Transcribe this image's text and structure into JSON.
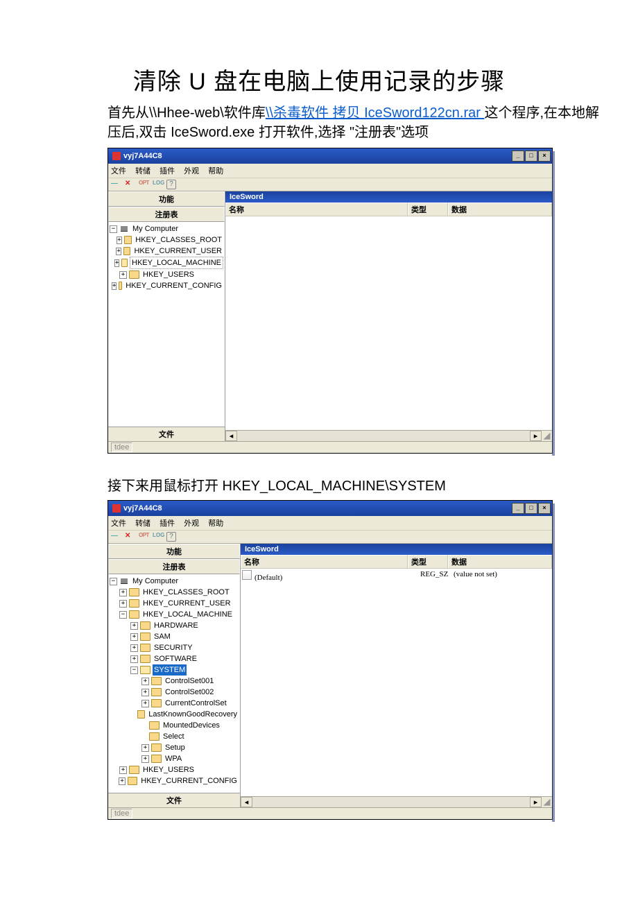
{
  "title": "清除 U 盘在电脑上使用记录的步骤",
  "intro_pre": "首先从\\\\Hhee-web\\软件库",
  "intro_link": "\\\\杀毒软件  拷贝 IceSword122cn.rar ",
  "intro_post": "这个程序,在本地解压后,双击 IceSword.exe 打开软件,选择  \"注册表\"选项",
  "step2": "接下来用鼠标打开 HKEY_LOCAL_MACHINE\\SYSTEM",
  "app": {
    "title": "vyj7A44C8",
    "menu": [
      "文件",
      "转储",
      "插件",
      "外观",
      "帮助"
    ],
    "panel_func": "功能",
    "panel_reg": "注册表",
    "panel_file": "文件",
    "content_title": "IceSword",
    "col_name": "名称",
    "col_type": "类型",
    "col_data": "数据",
    "status": "tdee"
  },
  "tree1": {
    "root": "My Computer",
    "keys": [
      "HKEY_CLASSES_ROOT",
      "HKEY_CURRENT_USER",
      "HKEY_LOCAL_MACHINE",
      "HKEY_USERS",
      "HKEY_CURRENT_CONFIG"
    ]
  },
  "tree2": {
    "root": "My Computer",
    "keys_top": [
      "HKEY_CLASSES_ROOT",
      "HKEY_CURRENT_USER"
    ],
    "hklm": "HKEY_LOCAL_MACHINE",
    "hklm_children": [
      "HARDWARE",
      "SAM",
      "SECURITY",
      "SOFTWARE"
    ],
    "system": "SYSTEM",
    "system_children_exp": [
      "ControlSet001",
      "ControlSet002",
      "CurrentControlSet"
    ],
    "system_children_leaf": [
      "LastKnownGoodRecovery",
      "MountedDevices",
      "Select"
    ],
    "system_children_exp2": [
      "Setup",
      "WPA"
    ],
    "keys_bottom": [
      "HKEY_USERS",
      "HKEY_CURRENT_CONFIG"
    ]
  },
  "values2": {
    "name": "(Default)",
    "type": "REG_SZ",
    "data": "(value not set)"
  }
}
